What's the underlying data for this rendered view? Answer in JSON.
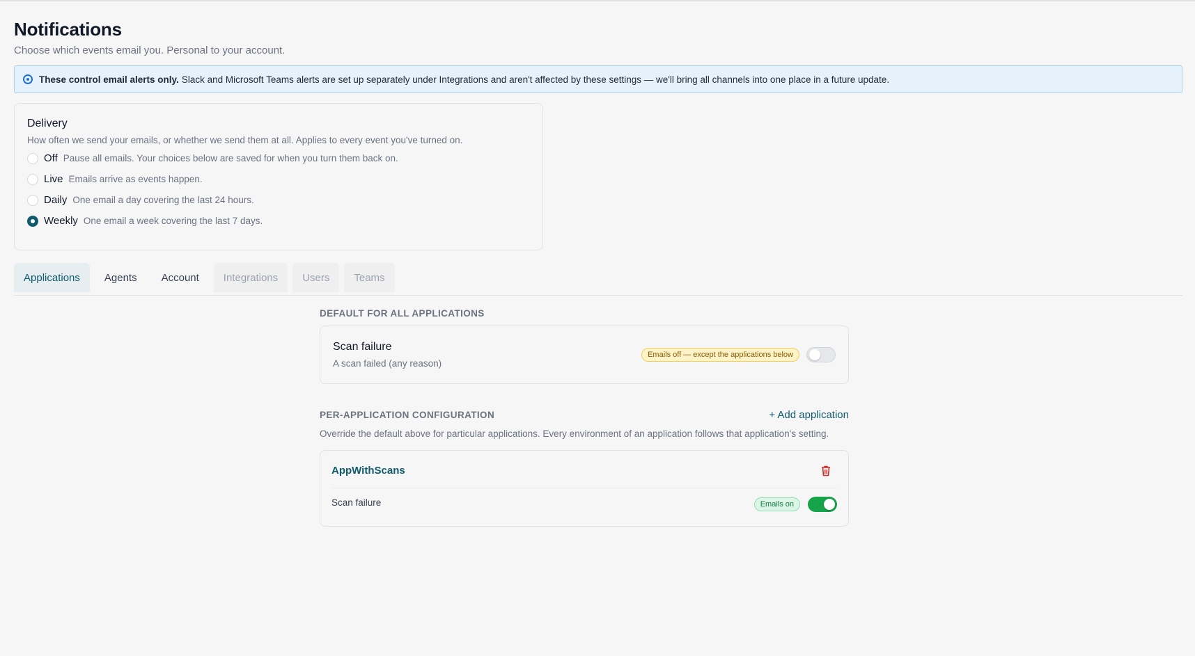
{
  "header": {
    "title": "Notifications",
    "subtitle": "Choose which events email you. Personal to your account."
  },
  "info_banner": {
    "icon": "info-circle-icon",
    "bold_text": "These control email alerts only.",
    "text": "Slack and Microsoft Teams alerts are set up separately under Integrations and aren't affected by these settings — we'll bring all channels into one place in a future update."
  },
  "delivery": {
    "title": "Delivery",
    "description": "How often we send your emails, or whether we send them at all. Applies to every event you've turned on.",
    "options": [
      {
        "label": "Off",
        "description": "Pause all emails. Your choices below are saved for when you turn them back on.",
        "selected": false
      },
      {
        "label": "Live",
        "description": "Emails arrive as events happen.",
        "selected": false
      },
      {
        "label": "Daily",
        "description": "One email a day covering the last 24 hours.",
        "selected": false
      },
      {
        "label": "Weekly",
        "description": "One email a week covering the last 7 days.",
        "selected": true
      }
    ]
  },
  "tabs": [
    {
      "label": "Applications",
      "state": "active"
    },
    {
      "label": "Agents",
      "state": "normal"
    },
    {
      "label": "Account",
      "state": "normal"
    },
    {
      "label": "Integrations",
      "state": "disabled"
    },
    {
      "label": "Users",
      "state": "disabled"
    },
    {
      "label": "Teams",
      "state": "disabled"
    }
  ],
  "defaults": {
    "heading": "DEFAULT FOR ALL APPLICATIONS",
    "event_title": "Scan failure",
    "event_description": "A scan failed (any reason)",
    "badge": "Emails off — except the applications below",
    "enabled": false
  },
  "per_app": {
    "heading": "PER-APPLICATION CONFIGURATION",
    "add_label": "+ Add application",
    "description": "Override the default above for particular applications. Every environment of an application follows that application's setting.",
    "apps": [
      {
        "name": "AppWithScans",
        "delete_icon": "trash-icon",
        "event": "Scan failure",
        "badge": "Emails on",
        "enabled": true
      }
    ]
  },
  "colors": {
    "accent": "#0f5b6e",
    "info_bg": "#e6f2fb",
    "toggle_on": "#16a34a",
    "warn_badge_bg": "#fdf3c8",
    "ok_badge_bg": "#dbf6e6",
    "danger": "#dc2626"
  }
}
